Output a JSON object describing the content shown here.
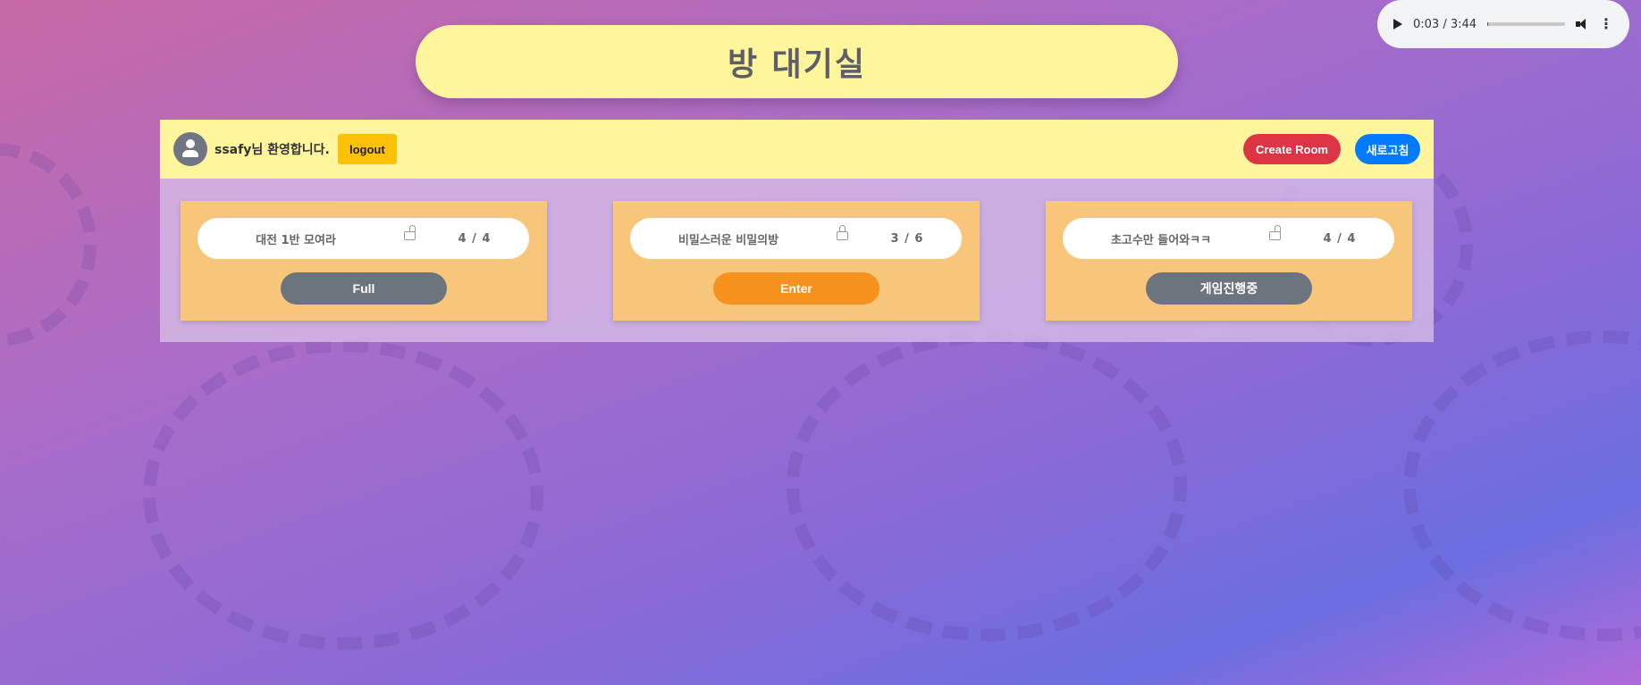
{
  "title": "방 대기실",
  "audio": {
    "time": "0:03 / 3:44",
    "progress": 0.014
  },
  "user": {
    "welcome": "ssafy님 환영합니다.",
    "logout_label": "logout"
  },
  "toolbar": {
    "create_label": "Create Room",
    "refresh_label": "새로고침"
  },
  "rooms": [
    {
      "name": "대전 1반 모여라",
      "count": "4 / 4",
      "locked": false,
      "action": "Full",
      "action_color": "#6c757d"
    },
    {
      "name": "비밀스러운 비밀의방",
      "count": "3 / 6",
      "locked": true,
      "action": "Enter",
      "action_color": "#f7921e"
    },
    {
      "name": "초고수만 들어와ㅋㅋ",
      "count": "4 / 4",
      "locked": false,
      "action": "게임진행중",
      "action_color": "#6c757d"
    }
  ]
}
